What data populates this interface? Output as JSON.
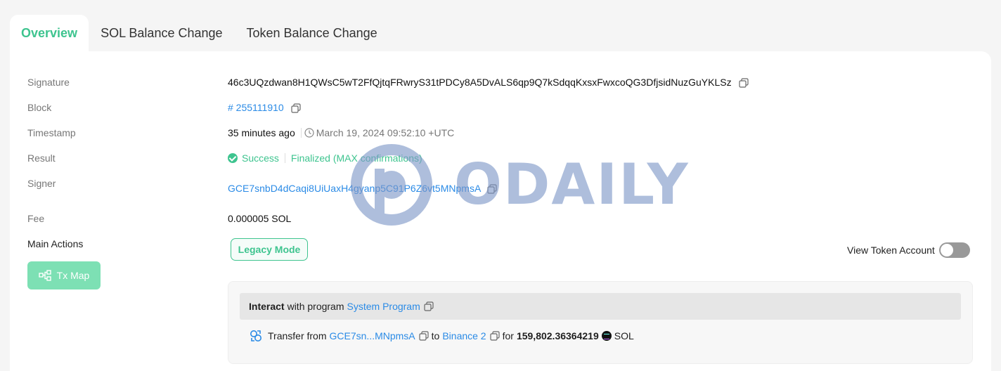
{
  "tabs": [
    {
      "label": "Overview"
    },
    {
      "label": "SOL Balance Change"
    },
    {
      "label": "Token Balance Change"
    }
  ],
  "overview": {
    "labels": {
      "signature": "Signature",
      "block": "Block",
      "timestamp": "Timestamp",
      "result": "Result",
      "signer": "Signer",
      "fee": "Fee",
      "main_actions": "Main Actions"
    },
    "signature": "46c3UQzdwan8H1QWsC5wT2FfQjtqFRwryS31tPDCy8A5DvALS6qp9Q7kSdqqKxsxFwxcoQG3DfjsidNuzGuYKLSz",
    "block": "# 255111910",
    "timestamp_relative": "35 minutes ago",
    "timestamp_absolute": "March 19, 2024 09:52:10 +UTC",
    "result_status": "Success",
    "result_finality": "Finalized (MAX confirmations)",
    "signer": "GCE7snbD4dCaqi8UiUaxH4gyanp5C91P6Z6vt5MNpmsA",
    "fee": "0.000005 SOL"
  },
  "buttons": {
    "legacy_mode": "Legacy Mode",
    "tx_map": "Tx Map",
    "view_token_account": "View Token Account"
  },
  "action": {
    "interact_word": "Interact",
    "with_program": "with program",
    "program": "System Program",
    "transfer_from": "Transfer from",
    "from_account": "GCE7sn...MNpmsA",
    "to_word": "to",
    "to_account": "Binance 2",
    "for_word": "for",
    "amount": "159,802.36364219",
    "token": "SOL"
  },
  "watermark": {
    "text": "ODAILY"
  },
  "colors": {
    "accent": "#3ec48f",
    "link": "#2b8be6",
    "watermark": "#7d97c8"
  }
}
